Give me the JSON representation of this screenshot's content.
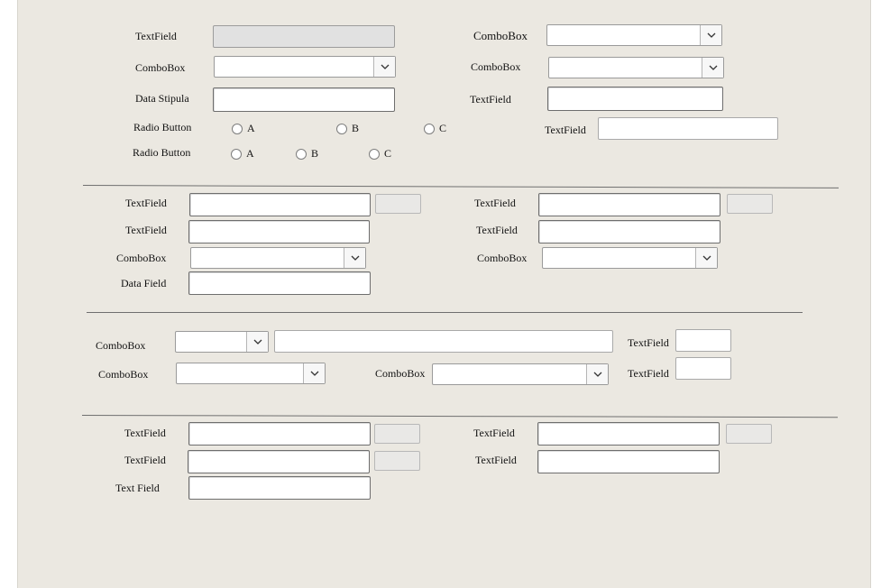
{
  "section1": {
    "textfield_label": "TextField",
    "combobox_label": "ComboBox",
    "data_stipula_label": "Data Stipula",
    "radio1_label": "Radio Button",
    "radio2_label": "Radio Button",
    "right_combobox1_label": "ComboBox",
    "right_combobox2_label": "ComboBox",
    "right_textfield_label": "TextField",
    "right_textfield2_label": "TextField",
    "radio1_options": [
      "A",
      "B",
      "C"
    ],
    "radio2_options": [
      "A",
      "B",
      "C"
    ]
  },
  "section2": {
    "left": [
      "TextField",
      "TextField",
      "ComboBox",
      "Data Field"
    ],
    "right": [
      "TextField",
      "TextField",
      "ComboBox"
    ]
  },
  "section3": {
    "combobox1_label": "ComboBox",
    "combobox2_label": "ComboBox",
    "combobox3_label": "ComboBox",
    "textfield1_label": "TextField",
    "textfield2_label": "TextField"
  },
  "section4": {
    "left": [
      "TextField",
      "TextField",
      "Text Field"
    ],
    "right": [
      "TextField",
      "TextField"
    ]
  }
}
